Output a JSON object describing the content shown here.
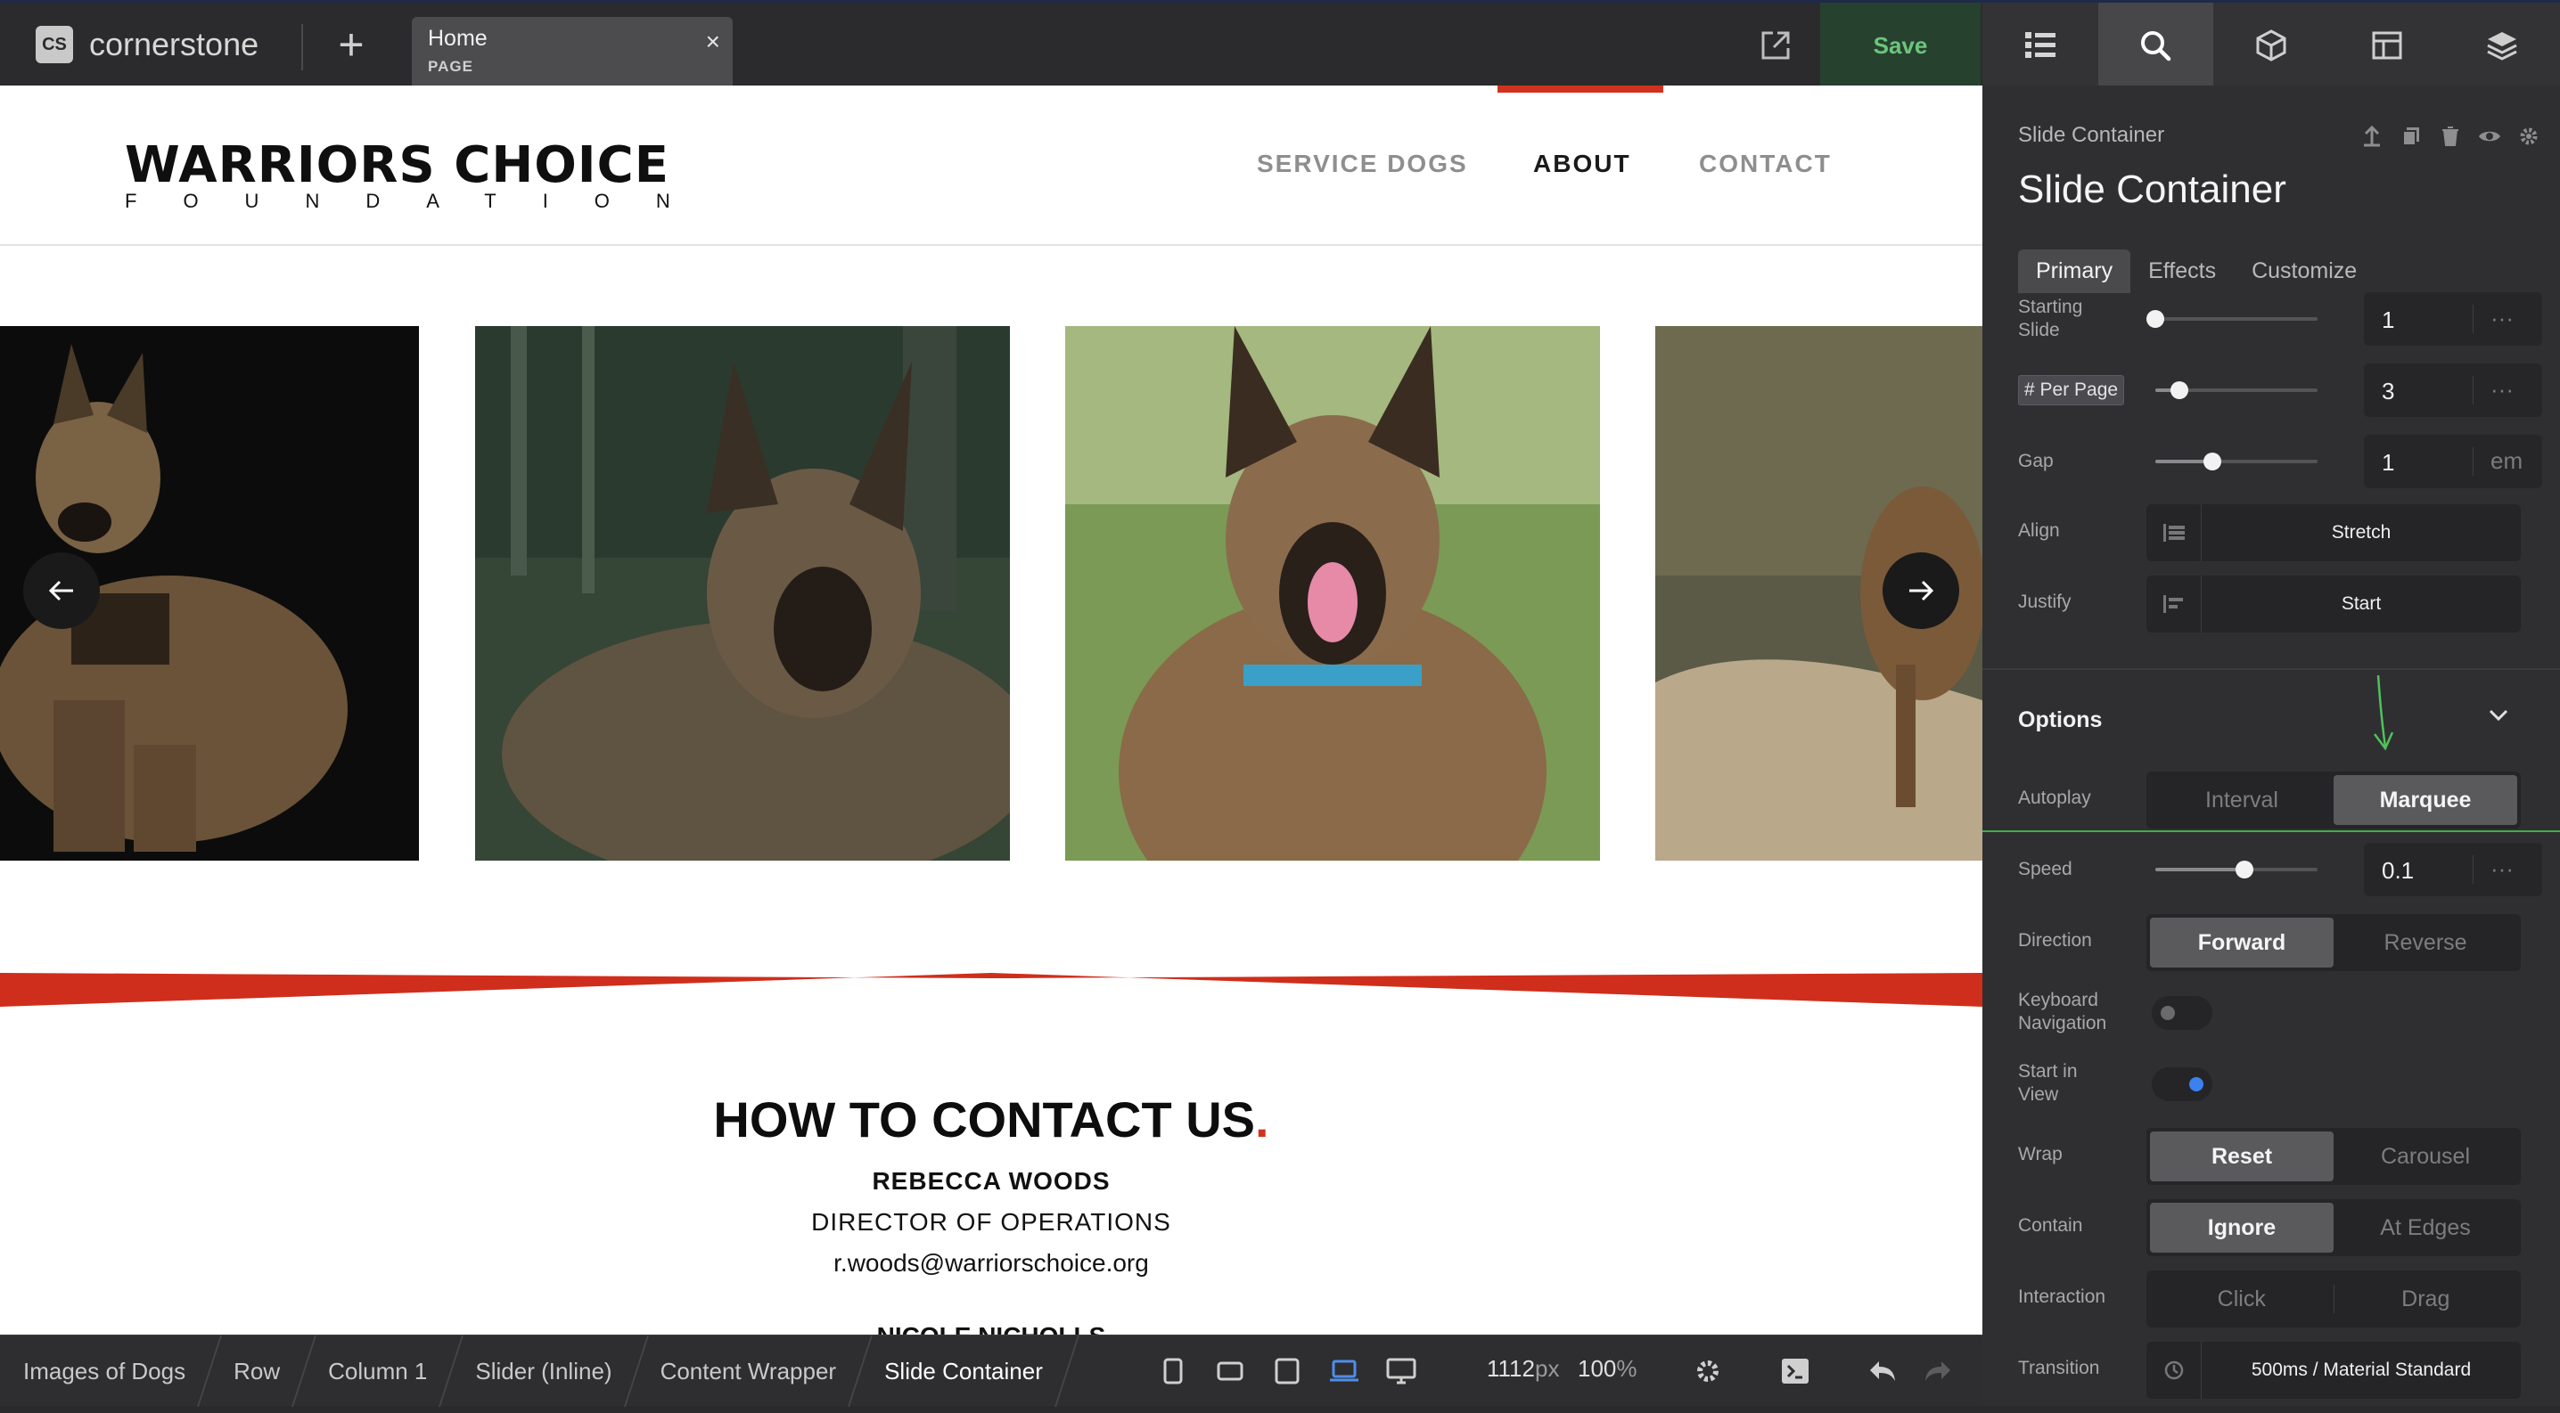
{
  "topbar": {
    "brand_badge": "CS",
    "brand_name": "cornerstone",
    "add_label": "+",
    "tab_title": "Home",
    "tab_subtitle": "PAGE",
    "tab_close": "×",
    "save_label": "Save",
    "right_tabs": [
      "list-icon",
      "search-icon",
      "cube-icon",
      "layout-icon",
      "layers-icon"
    ]
  },
  "site": {
    "brand_name": "WARRIORS CHOICE",
    "brand_sub": "FOUNDATION",
    "nav": [
      "SERVICE DOGS",
      "ABOUT",
      "CONTACT"
    ],
    "nav_active": "ABOUT",
    "accent": "#d1321f",
    "contact_heading": "HOW TO CONTACT US",
    "contact_heading_dot": ".",
    "contact_name": "REBECCA WOODS",
    "contact_role": "DIRECTOR OF OPERATIONS",
    "contact_email": "r.woods@warriorschoice.org",
    "contact_next": "NICOLE NICHOLLS"
  },
  "bottombar": {
    "breadcrumbs": [
      "Images of Dogs",
      "Row",
      "Column 1",
      "Slider (Inline)",
      "Content Wrapper",
      "Slide Container"
    ],
    "width_value": "1112",
    "width_unit": "px",
    "zoom_value": "100",
    "zoom_unit": "%"
  },
  "panel": {
    "breadcrumb": "Slide Container",
    "title": "Slide Container",
    "tabs": [
      "Primary",
      "Effects",
      "Customize"
    ],
    "active_tab": "Primary",
    "starting_slide": {
      "label": "Starting Slide",
      "value": "1",
      "more": "···",
      "level": 0
    },
    "per_page": {
      "label": "# Per Page",
      "value": "3",
      "more": "···",
      "level": 0.15
    },
    "gap": {
      "label": "Gap",
      "value": "1",
      "unit": "em",
      "level": 0.35
    },
    "align": {
      "label": "Align",
      "value": "Stretch"
    },
    "justify": {
      "label": "Justify",
      "value": "Start"
    },
    "options_title": "Options",
    "autoplay": {
      "label": "Autoplay",
      "options": [
        "Interval",
        "Marquee"
      ],
      "selected": "Marquee"
    },
    "speed": {
      "label": "Speed",
      "value": "0.1",
      "more": "···",
      "level": 0.55
    },
    "direction": {
      "label": "Direction",
      "options": [
        "Forward",
        "Reverse"
      ],
      "selected": "Forward"
    },
    "keyboard_nav": {
      "label": "Keyboard Navigation",
      "on": false
    },
    "start_in_view": {
      "label": "Start in View",
      "on": true
    },
    "wrap": {
      "label": "Wrap",
      "options": [
        "Reset",
        "Carousel"
      ],
      "selected": "Reset"
    },
    "contain": {
      "label": "Contain",
      "options": [
        "Ignore",
        "At Edges"
      ],
      "selected": "Ignore"
    },
    "interaction": {
      "label": "Interaction",
      "options": [
        "Click",
        "Drag"
      ],
      "selected": ""
    },
    "transition": {
      "label": "Transition",
      "value": "500ms / Material Standard"
    }
  }
}
